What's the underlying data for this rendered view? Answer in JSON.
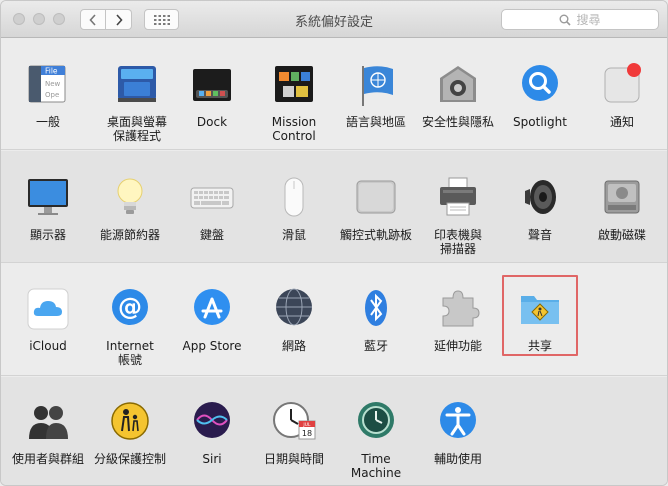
{
  "window": {
    "title": "系統偏好設定"
  },
  "search": {
    "placeholder": "搜尋"
  },
  "sections": [
    [
      {
        "label": "一般",
        "icon": "general-icon"
      },
      {
        "label": "桌面與螢幕\n保護程式",
        "icon": "desktop-screensaver-icon"
      },
      {
        "label": "Dock",
        "icon": "dock-icon"
      },
      {
        "label": "Mission\nControl",
        "icon": "mission-control-icon"
      },
      {
        "label": "語言與地區",
        "icon": "language-region-icon"
      },
      {
        "label": "安全性與隱私",
        "icon": "security-privacy-icon"
      },
      {
        "label": "Spotlight",
        "icon": "spotlight-icon"
      },
      {
        "label": "通知",
        "icon": "notifications-icon"
      }
    ],
    [
      {
        "label": "顯示器",
        "icon": "displays-icon"
      },
      {
        "label": "能源節約器",
        "icon": "energy-saver-icon"
      },
      {
        "label": "鍵盤",
        "icon": "keyboard-icon"
      },
      {
        "label": "滑鼠",
        "icon": "mouse-icon"
      },
      {
        "label": "觸控式軌跡板",
        "icon": "trackpad-icon"
      },
      {
        "label": "印表機與\n掃描器",
        "icon": "printers-scanners-icon"
      },
      {
        "label": "聲音",
        "icon": "sound-icon"
      },
      {
        "label": "啟動磁碟",
        "icon": "startup-disk-icon"
      }
    ],
    [
      {
        "label": "iCloud",
        "icon": "icloud-icon"
      },
      {
        "label": "Internet\n帳號",
        "icon": "internet-accounts-icon"
      },
      {
        "label": "App Store",
        "icon": "app-store-icon"
      },
      {
        "label": "網路",
        "icon": "network-icon"
      },
      {
        "label": "藍牙",
        "icon": "bluetooth-icon"
      },
      {
        "label": "延伸功能",
        "icon": "extensions-icon"
      },
      {
        "label": "共享",
        "icon": "sharing-icon"
      }
    ],
    [
      {
        "label": "使用者與群組",
        "icon": "users-groups-icon"
      },
      {
        "label": "分級保護控制",
        "icon": "parental-controls-icon"
      },
      {
        "label": "Siri",
        "icon": "siri-icon"
      },
      {
        "label": "日期與時間",
        "icon": "date-time-icon"
      },
      {
        "label": "Time Machine",
        "icon": "time-machine-icon"
      },
      {
        "label": "輔助使用",
        "icon": "accessibility-icon"
      }
    ]
  ],
  "icon_text": {
    "general_file": "File",
    "general_new": "New",
    "general_open": "Ope",
    "date_month": "JUL",
    "date_day": "18"
  }
}
